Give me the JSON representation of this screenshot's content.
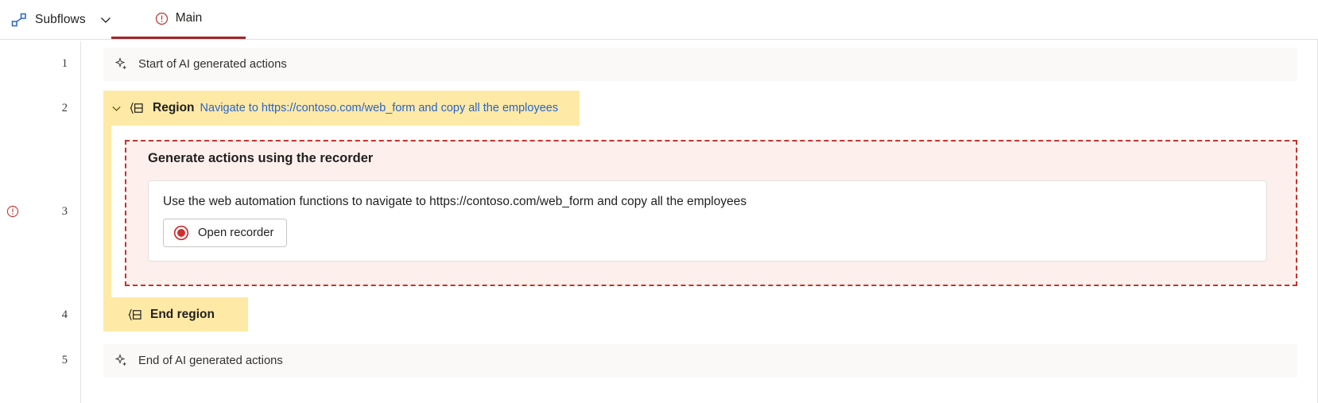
{
  "topbar": {
    "subflows": {
      "label": "Subflows",
      "icon": "subflow-icon",
      "chevron": "chevron-down-icon"
    },
    "tabs": [
      {
        "label": "Main",
        "icon": "error-circle-icon",
        "selected": true
      }
    ]
  },
  "colors": {
    "region_yellow": "#ffe9a6",
    "row_gray": "#faf9f8",
    "link_blue": "#2564cf",
    "error_red": "#a4262c",
    "dashed_red": "#c4332b",
    "panel_pink": "#fdf0ec"
  },
  "gutter": {
    "numbers": [
      "1",
      "2",
      "3",
      "4",
      "5"
    ],
    "error_marker_row": "3",
    "error_icon": "error-circle-icon"
  },
  "rows": {
    "start_ai": {
      "number": "1",
      "icon": "sparkle-icon",
      "text": "Start of AI generated actions"
    },
    "region": {
      "number": "2",
      "chevron": "chevron-down-icon",
      "icon": "region-icon",
      "title": "Region",
      "description": "Navigate to https://contoso.com/web_form and copy all the employees"
    },
    "recorder": {
      "number": "3",
      "heading": "Generate actions using the recorder",
      "prompt": "Use the web automation functions to navigate to https://contoso.com/web_form and copy all the employees",
      "button_label": "Open recorder",
      "button_icon": "record-circle-icon"
    },
    "end_region": {
      "number": "4",
      "icon": "region-icon",
      "title": "End region"
    },
    "end_ai": {
      "number": "5",
      "icon": "sparkle-icon",
      "text": "End of AI generated actions"
    }
  }
}
